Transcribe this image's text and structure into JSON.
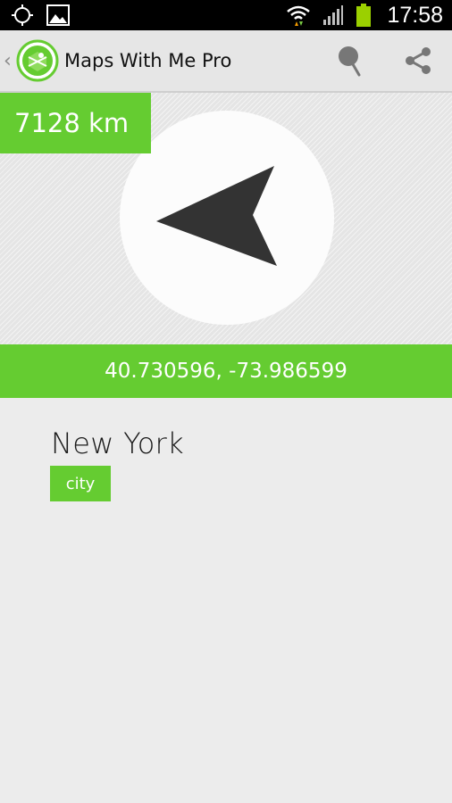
{
  "status_bar": {
    "time": "17:58",
    "icons": [
      "gps-icon",
      "gallery-icon",
      "wifi-icon",
      "signal-icon",
      "battery-icon"
    ],
    "battery_color": "#9bd000"
  },
  "action_bar": {
    "up_caret": "‹",
    "title": "Maps With Me Pro",
    "icons": [
      "app-logo",
      "pin-icon",
      "share-icon"
    ]
  },
  "compass": {
    "distance": "7128 km",
    "arrow_icon": "direction-arrow-icon"
  },
  "location": {
    "coordinates": "40.730596, -73.986599",
    "name": "New York",
    "type": "city"
  },
  "colors": {
    "accent": "#65cc31",
    "background": "#ececec",
    "action_bar": "#e6e6e6",
    "arrow": "#333333"
  }
}
